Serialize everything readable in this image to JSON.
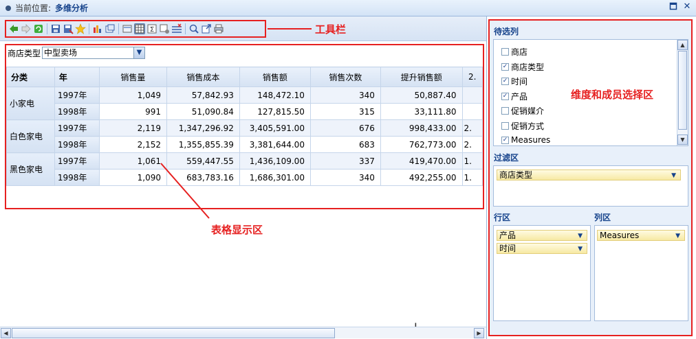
{
  "title_bar": {
    "location_label": "当前位置:",
    "location_value": "多维分析"
  },
  "annotations": {
    "toolbar": "工具栏",
    "table_area": "表格显示区",
    "selector_area": "维度和成员选择区"
  },
  "toolbar_icons": [
    "back-icon",
    "forward-icon",
    "refresh-icon",
    "save-icon",
    "save-as-icon",
    "favorite-icon",
    "chart-icon",
    "window-icon",
    "properties-icon",
    "grid-icon",
    "sum-icon",
    "format-icon",
    "remove-icon",
    "zoom-icon",
    "export-icon",
    "print-icon"
  ],
  "filter": {
    "label": "商店类型",
    "value": "中型卖场"
  },
  "table": {
    "headers": [
      "分类",
      "年",
      "销售量",
      "销售成本",
      "销售额",
      "销售次数",
      "提升销售额",
      "2."
    ],
    "groups": [
      {
        "category": "小家电",
        "rows": [
          {
            "year": "1997年",
            "values": [
              "1,049",
              "57,842.93",
              "148,472.10",
              "340",
              "50,887.40"
            ]
          },
          {
            "year": "1998年",
            "values": [
              "991",
              "51,090.84",
              "127,815.50",
              "315",
              "33,111.80"
            ]
          }
        ]
      },
      {
        "category": "白色家电",
        "rows": [
          {
            "year": "1997年",
            "values": [
              "2,119",
              "1,347,296.92",
              "3,405,591.00",
              "676",
              "998,433.00"
            ],
            "extra": "2."
          },
          {
            "year": "1998年",
            "values": [
              "2,152",
              "1,355,855.39",
              "3,381,644.00",
              "683",
              "762,773.00"
            ],
            "extra": "2."
          }
        ]
      },
      {
        "category": "黑色家电",
        "rows": [
          {
            "year": "1997年",
            "values": [
              "1,061",
              "559,447.55",
              "1,436,109.00",
              "337",
              "419,470.00"
            ],
            "extra": "1."
          },
          {
            "year": "1998年",
            "values": [
              "1,090",
              "683,783.16",
              "1,686,301.00",
              "340",
              "492,255.00"
            ],
            "extra": "1."
          }
        ]
      }
    ]
  },
  "right_panel": {
    "candidate_title": "待选列",
    "candidates": [
      {
        "label": "商店",
        "checked": false
      },
      {
        "label": "商店类型",
        "checked": true
      },
      {
        "label": "时间",
        "checked": true
      },
      {
        "label": "产品",
        "checked": true
      },
      {
        "label": "促销媒介",
        "checked": false
      },
      {
        "label": "促销方式",
        "checked": false
      },
      {
        "label": "Measures",
        "checked": true
      }
    ],
    "filter_title": "过滤区",
    "filter_items": [
      "商店类型"
    ],
    "row_title": "行区",
    "row_items": [
      "产品",
      "时间"
    ],
    "col_title": "列区",
    "col_items": [
      "Measures"
    ]
  },
  "colors": {
    "accent": "#15428b",
    "annotation": "#e62020",
    "pill_bg": "#f7e9a3"
  }
}
